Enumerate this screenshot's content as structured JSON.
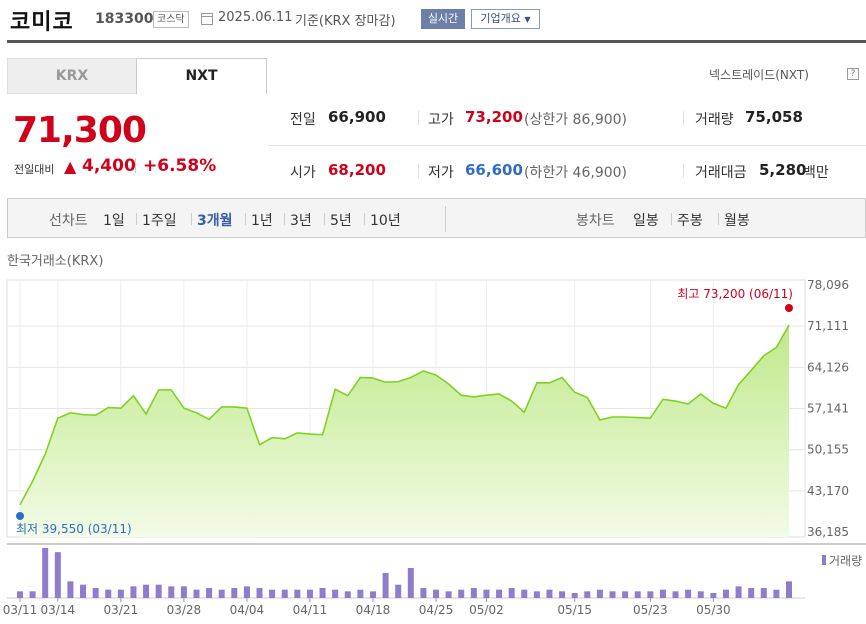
{
  "header": {
    "name": "코미코",
    "code": "183300",
    "market": "코스닥",
    "date": "2025.06.11",
    "basis": "기준(KRX 장마감)",
    "realtime": "실시간",
    "overview": "기업개요"
  },
  "tabs": [
    {
      "label": "KRX",
      "selected": false
    },
    {
      "label": "NXT",
      "selected": true
    }
  ],
  "nxt_title": "넥스트레이드(NXT)",
  "help_glyph": "?",
  "quote": {
    "price": "71,300",
    "change_label": "전일대비",
    "change_icon": "up-triangle-icon",
    "change_glyph": "▲",
    "change": "4,400",
    "change_pct": "+6.58%",
    "prev_label": "전일",
    "prev": "66,900",
    "high_label": "고가",
    "high": "73,200",
    "upper_limit": "(상한가 86,900)",
    "volume_label": "거래량",
    "volume": "75,058",
    "open_label": "시가",
    "open": "68,200",
    "low_label": "저가",
    "low": "66,600",
    "lower_limit": "(하한가 46,900)",
    "value_label": "거래대금",
    "value": "5,280",
    "value_unit": "백만"
  },
  "colors": {
    "up": "#d0021b",
    "down": "#2f6cc6",
    "line": "#7ed321",
    "volume": "#8f7ccd"
  },
  "periods": {
    "line_label": "선차트",
    "line_items": [
      "1일",
      "1주일",
      "3개월",
      "1년",
      "3년",
      "5년",
      "10년"
    ],
    "selected": "3개월",
    "candle_label": "봉차트",
    "candle_items": [
      "일봉",
      "주봉",
      "월봉"
    ]
  },
  "exchange_label": "한국거래소(KRX)",
  "chart_data": {
    "type": "area",
    "ylim": [
      36185,
      78096
    ],
    "yticks": [
      "78,096",
      "71,111",
      "64,126",
      "57,141",
      "50,155",
      "43,170",
      "36,185"
    ],
    "x": [
      "03/11",
      "03/12",
      "03/13",
      "03/14",
      "03/17",
      "03/18",
      "03/19",
      "03/20",
      "03/21",
      "03/24",
      "03/25",
      "03/26",
      "03/27",
      "03/28",
      "03/31",
      "04/01",
      "04/02",
      "04/03",
      "04/04",
      "04/07",
      "04/08",
      "04/09",
      "04/10",
      "04/11",
      "04/14",
      "04/15",
      "04/16",
      "04/17",
      "04/18",
      "04/21",
      "04/22",
      "04/23",
      "04/24",
      "04/25",
      "04/28",
      "04/29",
      "04/30",
      "05/02",
      "05/07",
      "05/08",
      "05/09",
      "05/12",
      "05/13",
      "05/14",
      "05/15",
      "05/16",
      "05/19",
      "05/20",
      "05/21",
      "05/22",
      "05/23",
      "05/26",
      "05/27",
      "05/28",
      "05/29",
      "05/30",
      "06/02",
      "06/04",
      "06/05",
      "06/09",
      "06/10",
      "06/11"
    ],
    "xticks": [
      "03/11",
      "03/14",
      "03/21",
      "03/28",
      "04/04",
      "04/11",
      "04/18",
      "04/25",
      "05/02",
      "05/15",
      "05/23",
      "05/30"
    ],
    "values": [
      40800,
      44800,
      49400,
      55500,
      56400,
      56100,
      56000,
      57300,
      57200,
      59300,
      56200,
      60300,
      60300,
      57200,
      56400,
      55300,
      57400,
      57400,
      57200,
      51000,
      52200,
      52000,
      53000,
      52800,
      52700,
      60400,
      59300,
      62400,
      62300,
      61600,
      61700,
      62400,
      63500,
      62800,
      61300,
      59400,
      59100,
      59400,
      59600,
      58400,
      56500,
      61500,
      61500,
      62400,
      59900,
      59000,
      55200,
      55700,
      55700,
      55600,
      55500,
      58700,
      58400,
      57900,
      59600,
      58000,
      57200,
      61200,
      63600,
      66100,
      67500,
      71300
    ],
    "volume": [
      8,
      8,
      60,
      55,
      20,
      16,
      12,
      10,
      10,
      14,
      16,
      16,
      14,
      14,
      10,
      12,
      10,
      12,
      14,
      12,
      10,
      10,
      10,
      10,
      12,
      10,
      8,
      10,
      8,
      30,
      16,
      36,
      12,
      10,
      8,
      10,
      12,
      10,
      10,
      12,
      10,
      8,
      10,
      8,
      6,
      8,
      10,
      8,
      8,
      8,
      8,
      10,
      8,
      10,
      8,
      6,
      10,
      14,
      12,
      12,
      10,
      20
    ],
    "max_label": "최고 73,200 (06/11)",
    "min_label": "최저 39,550 (03/11)",
    "volume_legend": "거래량"
  }
}
